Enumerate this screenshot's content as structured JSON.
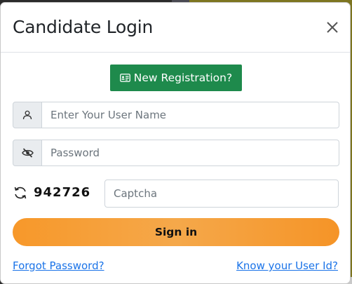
{
  "modal": {
    "title": "Candidate Login",
    "close_icon": "close-icon"
  },
  "registration_button": {
    "label": "New Registration?",
    "icon": "id-card-icon",
    "color": "#1e8a4c"
  },
  "username": {
    "placeholder": "Enter Your User Name",
    "value": "",
    "icon": "user-icon"
  },
  "password": {
    "placeholder": "Password",
    "value": "",
    "icon": "eye-slash-icon"
  },
  "captcha": {
    "code": "942726",
    "placeholder": "Captcha",
    "value": "",
    "icon": "refresh-icon"
  },
  "signin_button": {
    "label": "Sign in",
    "color": "#f7982a"
  },
  "links": {
    "forgot_password": "Forgot Password?",
    "know_user_id": "Know your User Id?",
    "color": "#1a73e8"
  }
}
